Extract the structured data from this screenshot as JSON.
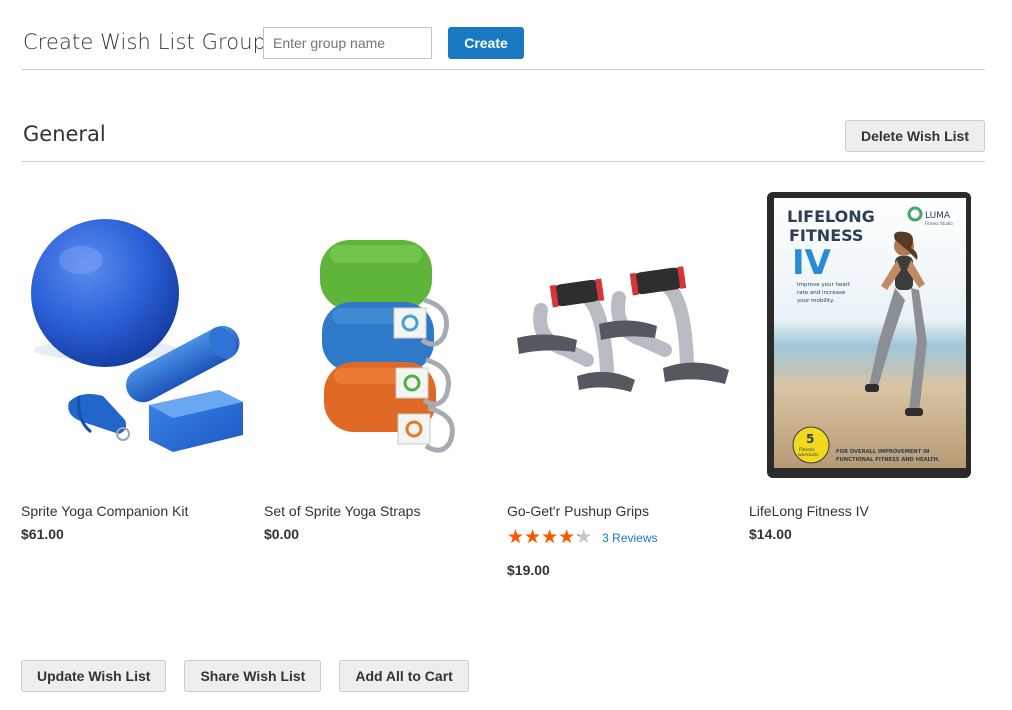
{
  "create_group": {
    "title": "Create Wish List Group",
    "input_placeholder": "Enter group name",
    "input_value": "",
    "create_label": "Create"
  },
  "wishlist": {
    "name": "General",
    "delete_label": "Delete Wish List"
  },
  "products": [
    {
      "name": "Sprite Yoga Companion Kit",
      "price": "$61.00",
      "image_icon": "yoga-kit-image"
    },
    {
      "name": "Set of Sprite Yoga Straps",
      "price": "$0.00",
      "image_icon": "yoga-straps-image"
    },
    {
      "name": "Go-Get'r Pushup Grips",
      "price": "$19.00",
      "image_icon": "pushup-grips-image",
      "rating_percent": 85,
      "reviews_label": "3 Reviews"
    },
    {
      "name": "LifeLong Fitness IV",
      "price": "$14.00",
      "image_icon": "dvd-cover-image",
      "cover": {
        "title_line1": "LIFELONG",
        "title_line2": "FITNESS",
        "title_line3": "IV",
        "brand": "LUMA",
        "brand_sub": "Fitness Studio",
        "tagline_1": "Improve your heart",
        "tagline_2": "rate and increase",
        "tagline_3": "your mobility.",
        "badge_number": "5",
        "badge_text_1": "Fitness",
        "badge_text_2": "workouts",
        "footer_1": "FOR OVERALL IMPROVEMENT IN",
        "footer_2": "FUNCTIONAL FITNESS AND HEALTH."
      }
    }
  ],
  "actions": {
    "update_label": "Update Wish List",
    "share_label": "Share Wish List",
    "add_all_label": "Add All to Cart"
  },
  "colors": {
    "primary": "#1979c3",
    "star": "#ff5501",
    "star_empty": "#c7c7c7",
    "secondary_button": "#eeeeee"
  }
}
